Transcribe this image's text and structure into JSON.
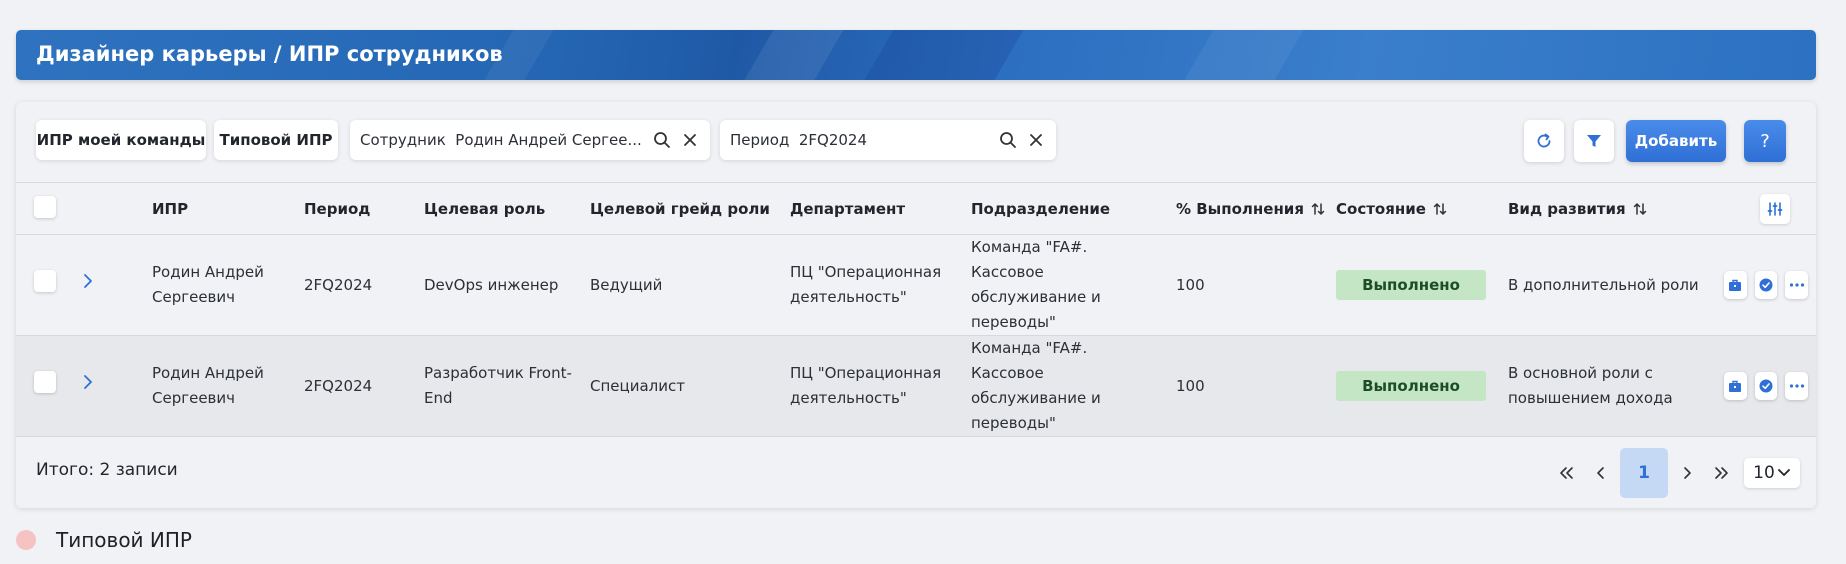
{
  "header": {
    "title": "Дизайнер карьеры / ИПР сотрудников"
  },
  "toolbar": {
    "my_team_label": "ИПР моей команды",
    "typical_label": "Типовой ИПР",
    "employee_filter_value": "Сотрудник  Родин Андрей Сергее...",
    "period_filter_value": "Период  2FQ2024",
    "add_label": "Добавить",
    "help_label": "?"
  },
  "table": {
    "columns": {
      "ipr": "ИПР",
      "period": "Период",
      "target_role": "Целевая роль",
      "target_grade": "Целевой грейд роли",
      "department": "Департамент",
      "division": "Подразделение",
      "completion": "% Выполнения",
      "state": "Состояние",
      "dev_type": "Вид развития"
    },
    "rows": [
      {
        "ipr": "Родин Андрей Сергеевич",
        "period": "2FQ2024",
        "target_role": "DevOps инженер",
        "target_grade": "Ведущий",
        "department": "ПЦ \"Операционная деятельность\"",
        "division": "Команда \"FA#. Кассовое обслуживание и переводы\"",
        "completion": "100",
        "state": "Выполнено",
        "dev_type": "В дополнительной роли"
      },
      {
        "ipr": "Родин Андрей Сергеевич",
        "period": "2FQ2024",
        "target_role": "Разработчик Front-End",
        "target_grade": "Специалист",
        "department": "ПЦ \"Операционная деятельность\"",
        "division": "Команда \"FA#. Кассовое обслуживание и переводы\"",
        "completion": "100",
        "state": "Выполнено",
        "dev_type": "В основной роли с повышением дохода"
      }
    ]
  },
  "footer": {
    "total": "Итого: 2 записи",
    "current_page": "1",
    "page_size": "10"
  },
  "legend": {
    "label": "Типовой ИПР"
  },
  "colors": {
    "accent": "#2f6fd6",
    "status_done_bg": "#c5e6c4",
    "legend_dot": "#f6c3c3"
  }
}
